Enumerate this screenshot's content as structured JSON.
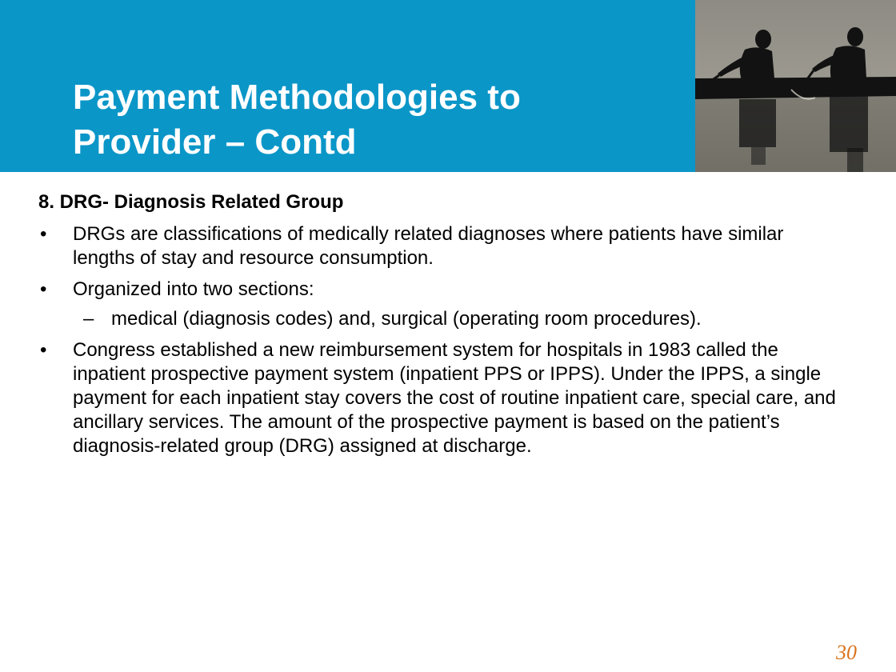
{
  "slide": {
    "title_line1": "Payment Methodologies to",
    "title_line2": "Provider – Contd",
    "heading": "8. DRG- Diagnosis Related Group",
    "bullet_mark": "•",
    "sub_mark": "–",
    "bullets": [
      "DRGs are classifications of medically related diagnoses where patients have similar lengths of stay and resource consumption.",
      "Organized into two sections:",
      "Congress established a new reimbursement system for hospitals in 1983 called the inpatient prospective payment system (inpatient PPS or IPPS). Under the IPPS, a single payment for each inpatient stay covers the cost of routine inpatient care, special care, and ancillary services. The amount of the prospective payment is based on the patient’s diagnosis-related group (DRG) assigned at discharge."
    ],
    "sub_bullets": [
      "medical (diagnosis codes) and, surgical (operating room procedures)."
    ],
    "page_number": "30"
  },
  "colors": {
    "header_blue": "#0b96c8",
    "page_number_orange": "#d9731b"
  },
  "icons": {
    "header_image": "rowers-photo"
  }
}
